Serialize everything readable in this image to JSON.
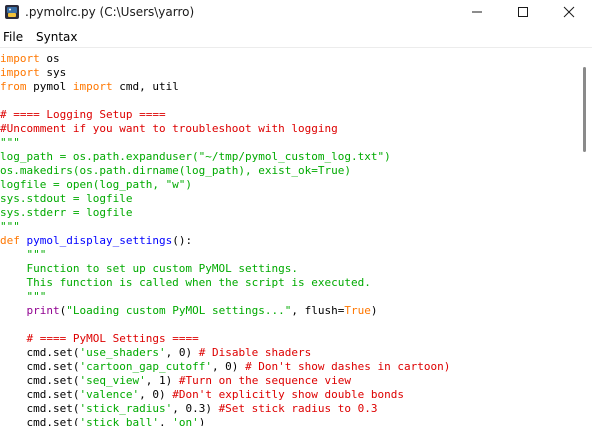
{
  "window": {
    "title": ".pymolrc.py (C:\\Users\\yarro)",
    "icon": "idle-python-icon"
  },
  "menubar": {
    "items": [
      "File",
      "Syntax"
    ]
  },
  "colors": {
    "keyword": "#ff7700",
    "builtin": "#900090",
    "string": "#00aa00",
    "comment": "#dd0000",
    "definition": "#0000ff",
    "default": "#000000"
  },
  "editor": {
    "lines": [
      {
        "tokens": [
          {
            "t": "import",
            "c": "keyword"
          },
          {
            "t": " os",
            "c": "default"
          }
        ]
      },
      {
        "tokens": [
          {
            "t": "import",
            "c": "keyword"
          },
          {
            "t": " sys",
            "c": "default"
          }
        ]
      },
      {
        "tokens": [
          {
            "t": "from",
            "c": "keyword"
          },
          {
            "t": " pymol ",
            "c": "default"
          },
          {
            "t": "import",
            "c": "keyword"
          },
          {
            "t": " cmd, util",
            "c": "default"
          }
        ]
      },
      {
        "tokens": []
      },
      {
        "tokens": [
          {
            "t": "# ==== Logging Setup ====",
            "c": "comment"
          }
        ]
      },
      {
        "tokens": [
          {
            "t": "#Uncomment if you want to troubleshoot with logging",
            "c": "comment"
          }
        ]
      },
      {
        "tokens": [
          {
            "t": "\"\"\"",
            "c": "string"
          }
        ]
      },
      {
        "tokens": [
          {
            "t": "log_path = os.path.expanduser(\"~/tmp/pymol_custom_log.txt\")",
            "c": "string"
          }
        ]
      },
      {
        "tokens": [
          {
            "t": "os.makedirs(os.path.dirname(log_path), exist_ok=True)",
            "c": "string"
          }
        ]
      },
      {
        "tokens": [
          {
            "t": "logfile = open(log_path, \"w\")",
            "c": "string"
          }
        ]
      },
      {
        "tokens": [
          {
            "t": "sys.stdout = logfile",
            "c": "string"
          }
        ]
      },
      {
        "tokens": [
          {
            "t": "sys.stderr = logfile",
            "c": "string"
          }
        ]
      },
      {
        "tokens": [
          {
            "t": "\"\"\"",
            "c": "string"
          }
        ]
      },
      {
        "tokens": [
          {
            "t": "def",
            "c": "keyword"
          },
          {
            "t": " ",
            "c": "default"
          },
          {
            "t": "pymol_display_settings",
            "c": "definition"
          },
          {
            "t": "():",
            "c": "default"
          }
        ]
      },
      {
        "tokens": [
          {
            "t": "    \"\"\"",
            "c": "string"
          }
        ]
      },
      {
        "tokens": [
          {
            "t": "    Function to set up custom PyMOL settings.",
            "c": "string"
          }
        ]
      },
      {
        "tokens": [
          {
            "t": "    This function is called when the script is executed.",
            "c": "string"
          }
        ]
      },
      {
        "tokens": [
          {
            "t": "    \"\"\"",
            "c": "string"
          }
        ]
      },
      {
        "tokens": [
          {
            "t": "    ",
            "c": "default"
          },
          {
            "t": "print",
            "c": "builtin"
          },
          {
            "t": "(",
            "c": "default"
          },
          {
            "t": "\"Loading custom PyMOL settings...\"",
            "c": "string"
          },
          {
            "t": ", flush=",
            "c": "default"
          },
          {
            "t": "True",
            "c": "keyword"
          },
          {
            "t": ")",
            "c": "default"
          }
        ]
      },
      {
        "tokens": []
      },
      {
        "tokens": [
          {
            "t": "    ",
            "c": "default"
          },
          {
            "t": "# ==== PyMOL Settings ====",
            "c": "comment"
          }
        ]
      },
      {
        "tokens": [
          {
            "t": "    cmd.set(",
            "c": "default"
          },
          {
            "t": "'use_shaders'",
            "c": "string"
          },
          {
            "t": ", 0) ",
            "c": "default"
          },
          {
            "t": "# Disable shaders",
            "c": "comment"
          }
        ]
      },
      {
        "tokens": [
          {
            "t": "    cmd.set(",
            "c": "default"
          },
          {
            "t": "'cartoon_gap_cutoff'",
            "c": "string"
          },
          {
            "t": ", 0) ",
            "c": "default"
          },
          {
            "t": "# Don't show dashes in cartoon)",
            "c": "comment"
          }
        ]
      },
      {
        "tokens": [
          {
            "t": "    cmd.set(",
            "c": "default"
          },
          {
            "t": "'seq_view'",
            "c": "string"
          },
          {
            "t": ", 1) ",
            "c": "default"
          },
          {
            "t": "#Turn on the sequence view",
            "c": "comment"
          }
        ]
      },
      {
        "tokens": [
          {
            "t": "    cmd.set(",
            "c": "default"
          },
          {
            "t": "'valence'",
            "c": "string"
          },
          {
            "t": ", 0) ",
            "c": "default"
          },
          {
            "t": "#Don't explicitly show double bonds",
            "c": "comment"
          }
        ]
      },
      {
        "tokens": [
          {
            "t": "    cmd.set(",
            "c": "default"
          },
          {
            "t": "'stick_radius'",
            "c": "string"
          },
          {
            "t": ", 0.3) ",
            "c": "default"
          },
          {
            "t": "#Set stick radius to 0.3",
            "c": "comment"
          }
        ]
      },
      {
        "tokens": [
          {
            "t": "    cmd.set(",
            "c": "default"
          },
          {
            "t": "'stick_ball'",
            "c": "string"
          },
          {
            "t": ", ",
            "c": "default"
          },
          {
            "t": "'on'",
            "c": "string"
          },
          {
            "t": ")",
            "c": "default"
          }
        ]
      }
    ]
  }
}
